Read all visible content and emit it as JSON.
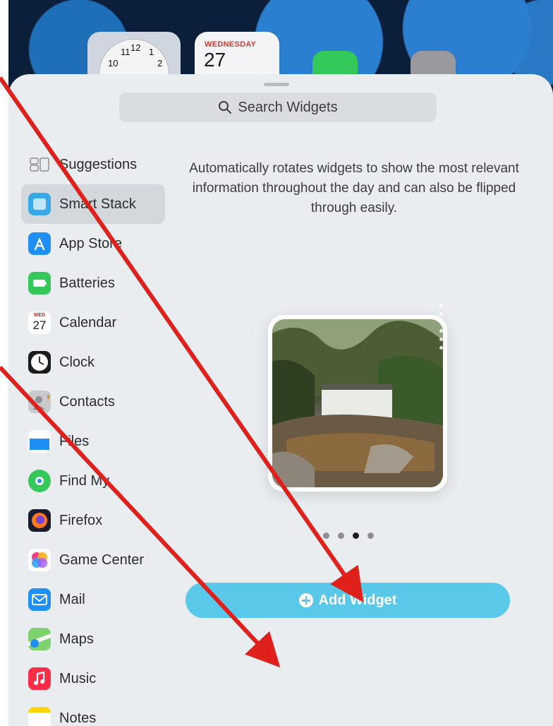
{
  "home_screen": {
    "calendar_widget": {
      "day": "WEDNESDAY",
      "date": "27"
    },
    "clock_numbers": [
      "11",
      "12",
      "1",
      "10",
      "2"
    ]
  },
  "search": {
    "placeholder": "Search Widgets"
  },
  "sidebar": {
    "items": [
      {
        "label": "Suggestions",
        "icon": "suggestions-icon"
      },
      {
        "label": "Smart Stack",
        "icon": "smart-stack-icon",
        "selected": true
      },
      {
        "label": "App Store",
        "icon": "app-store-icon"
      },
      {
        "label": "Batteries",
        "icon": "batteries-icon"
      },
      {
        "label": "Calendar",
        "icon": "calendar-icon",
        "icon_day": "WED",
        "icon_date": "27"
      },
      {
        "label": "Clock",
        "icon": "clock-icon"
      },
      {
        "label": "Contacts",
        "icon": "contacts-icon"
      },
      {
        "label": "Files",
        "icon": "files-icon"
      },
      {
        "label": "Find My",
        "icon": "find-my-icon"
      },
      {
        "label": "Firefox",
        "icon": "firefox-icon"
      },
      {
        "label": "Game Center",
        "icon": "game-center-icon"
      },
      {
        "label": "Mail",
        "icon": "mail-icon"
      },
      {
        "label": "Maps",
        "icon": "maps-icon"
      },
      {
        "label": "Music",
        "icon": "music-icon"
      },
      {
        "label": "Notes",
        "icon": "notes-icon"
      }
    ]
  },
  "main": {
    "description": "Automatically rotates widgets to show the most relevant information throughout the day and can also be flipped through easily.",
    "page_count": 4,
    "current_page": 3,
    "add_button_label": "Add Widget"
  },
  "colors": {
    "accent": "#5ac8e8",
    "annotation_arrow": "#e0201b",
    "sheet_background": "#e9edf0"
  }
}
